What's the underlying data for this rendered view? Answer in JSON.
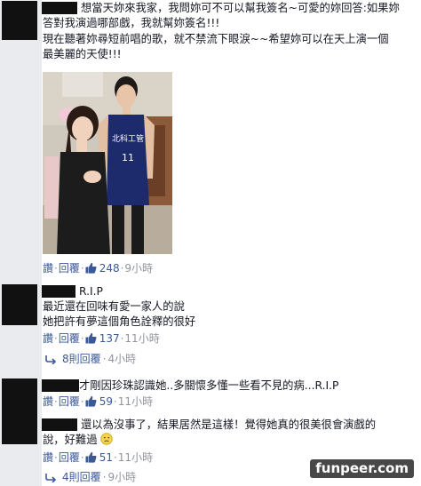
{
  "comments": [
    {
      "text_lines": [
        "想當天妳來我家，我問妳可不可以幫我簽名~可愛的妳回答:如果妳",
        "答對我演過哪部戲，我就幫妳簽名!!!",
        "現在聽著妳尋短前唱的歌，就不禁流下眼淚~~希望妳可以在天上演一個",
        "最美麗的天使!!!"
      ],
      "actions": {
        "like": "讚",
        "reply": "回覆",
        "likes": "248",
        "time": "9小時"
      }
    },
    {
      "name_suffix": "R.I.P",
      "text_lines": [
        "最近還在回味有愛一家人的說",
        "她把許有夢這個角色詮釋的很好"
      ],
      "actions": {
        "like": "讚",
        "reply": "回覆",
        "likes": "137",
        "time": "11小時"
      },
      "replies": {
        "label": "8則回覆",
        "time": "4小時"
      }
    },
    {
      "text_lines": [
        "才剛因珍珠認識她..多關懷多懂一些看不見的病...R.I.P"
      ],
      "actions": {
        "like": "讚",
        "reply": "回覆",
        "likes": "59",
        "time": "11小時"
      }
    },
    {
      "text_lines": [
        "還以為沒事了，結果居然是這樣！覺得她真的很美很會演戲的",
        "說，好難過"
      ],
      "actions": {
        "like": "讚",
        "reply": "回覆",
        "likes": "51",
        "time": "11小時"
      },
      "replies": {
        "label": "4則回覆",
        "time": "9小時"
      }
    }
  ],
  "photo": {
    "jersey_text": "北科工管",
    "jersey_number": "11"
  },
  "watermark": "funpeer.com",
  "colors": {
    "link": "#3b5998",
    "meta": "#90949c",
    "text": "#141823",
    "redact": "#111111"
  }
}
